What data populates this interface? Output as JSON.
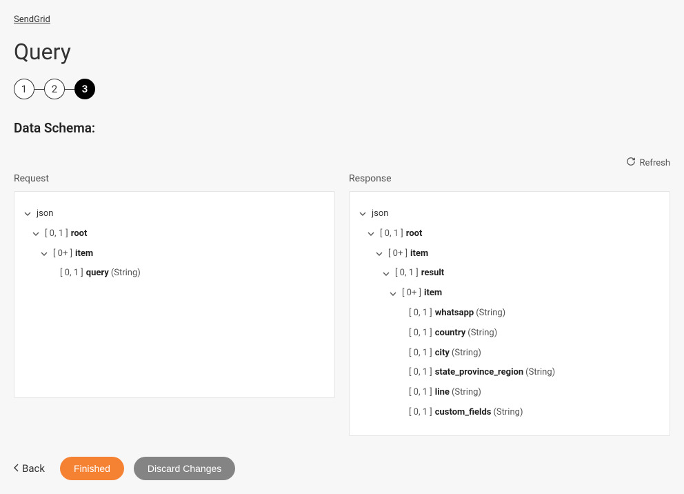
{
  "breadcrumb": "SendGrid",
  "page_title": "Query",
  "stepper": {
    "steps": [
      "1",
      "2",
      "3"
    ],
    "active_index": 2
  },
  "section_title": "Data Schema:",
  "refresh_label": "Refresh",
  "columns": {
    "request": {
      "title": "Request",
      "tree": [
        {
          "indent": 0,
          "caret": true,
          "label": "json"
        },
        {
          "indent": 1,
          "caret": true,
          "card": "[ 0, 1 ]",
          "bold": "root"
        },
        {
          "indent": 2,
          "caret": true,
          "card": "[ 0+ ]",
          "bold": "item"
        },
        {
          "indent": 3,
          "leaf": true,
          "card": "[ 0, 1 ]",
          "bold": "query",
          "type": "(String)"
        }
      ]
    },
    "response": {
      "title": "Response",
      "tree": [
        {
          "indent": 0,
          "caret": true,
          "label": "json"
        },
        {
          "indent": 1,
          "caret": true,
          "card": "[ 0, 1 ]",
          "bold": "root"
        },
        {
          "indent": 2,
          "caret": true,
          "card": "[ 0+ ]",
          "bold": "item"
        },
        {
          "indent": 3,
          "caret": true,
          "card": "[ 0, 1 ]",
          "bold": "result"
        },
        {
          "indent": 4,
          "caret": true,
          "card": "[ 0+ ]",
          "bold": "item"
        },
        {
          "indent": 5,
          "leaf": true,
          "card": "[ 0, 1 ]",
          "bold": "whatsapp",
          "type": "(String)"
        },
        {
          "indent": 5,
          "leaf": true,
          "card": "[ 0, 1 ]",
          "bold": "country",
          "type": "(String)"
        },
        {
          "indent": 5,
          "leaf": true,
          "card": "[ 0, 1 ]",
          "bold": "city",
          "type": "(String)"
        },
        {
          "indent": 5,
          "leaf": true,
          "card": "[ 0, 1 ]",
          "bold": "state_province_region",
          "type": "(String)"
        },
        {
          "indent": 5,
          "leaf": true,
          "card": "[ 0, 1 ]",
          "bold": "line",
          "type": "(String)"
        },
        {
          "indent": 5,
          "leaf": true,
          "card": "[ 0, 1 ]",
          "bold": "custom_fields",
          "type": "(String)"
        }
      ]
    }
  },
  "footer": {
    "back_label": "Back",
    "finished_label": "Finished",
    "discard_label": "Discard Changes"
  }
}
